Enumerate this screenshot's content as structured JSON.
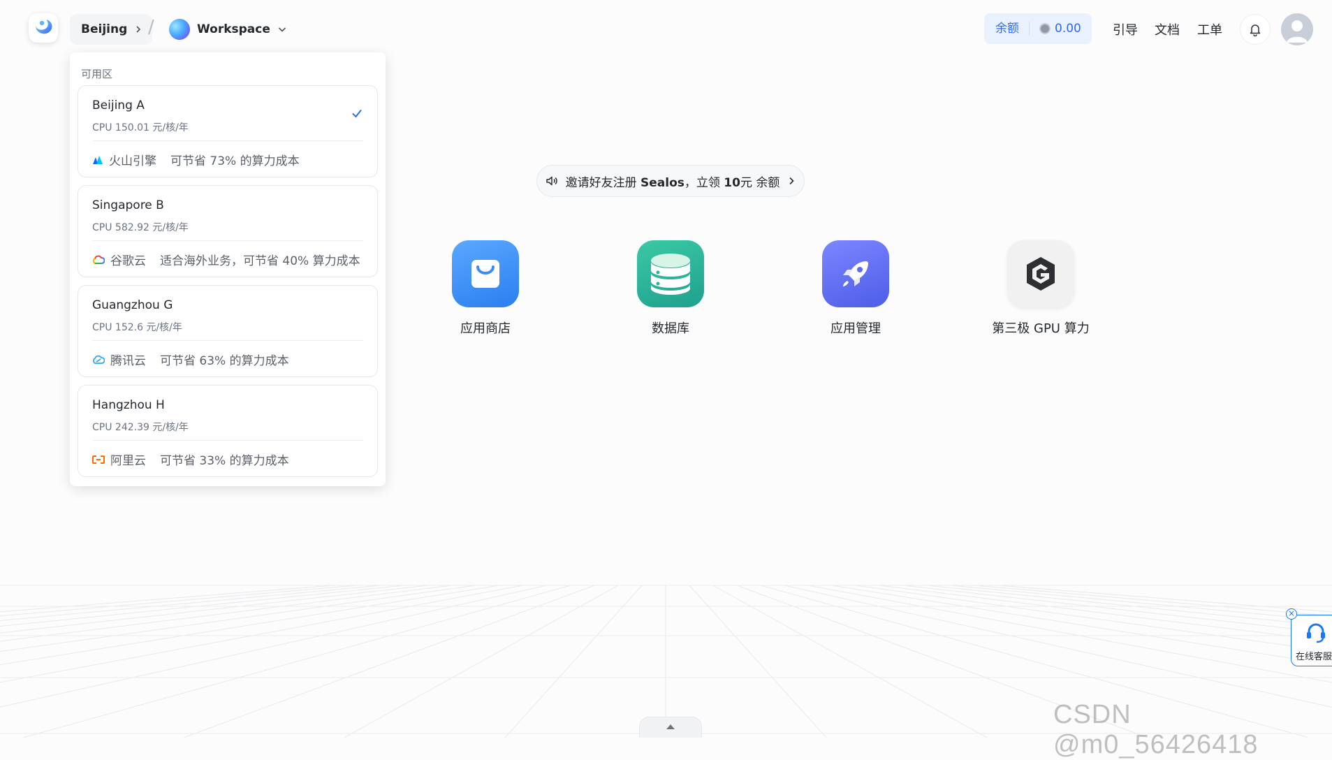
{
  "header": {
    "region": "Beijing",
    "workspace": "Workspace",
    "balance_label": "余额",
    "balance_value": "0.00",
    "nav": [
      "引导",
      "文档",
      "工单"
    ]
  },
  "dropdown": {
    "title": "可用区",
    "zones": [
      {
        "name": "Beijing A",
        "price": "CPU 150.01 元/核/年",
        "provider": "火山引擎",
        "note": "可节省 73% 的算力成本",
        "selected": true,
        "provider_color": "#1664ff"
      },
      {
        "name": "Singapore B",
        "price": "CPU 582.92 元/核/年",
        "provider": "谷歌云",
        "note": "适合海外业务，可节省 40% 算力成本",
        "selected": false,
        "provider_color": "#ea4335"
      },
      {
        "name": "Guangzhou G",
        "price": "CPU 152.6 元/核/年",
        "provider": "腾讯云",
        "note": "可节省 63% 的算力成本",
        "selected": false,
        "provider_color": "#2fa7f2"
      },
      {
        "name": "Hangzhou H",
        "price": "CPU 242.39 元/核/年",
        "provider": "阿里云",
        "note": "可节省 33% 的算力成本",
        "selected": false,
        "provider_color": "#ff6a00"
      }
    ]
  },
  "invite": {
    "pre": "邀请好友注册 ",
    "brand": "Sealos",
    "mid": "，立领 ",
    "amount": "10",
    "post": "元 余额"
  },
  "apps": [
    {
      "label": "应用商店",
      "icon": "shopping-bag-icon",
      "color": "#3b8cf6"
    },
    {
      "label": "数据库",
      "icon": "database-icon",
      "color": "#27b39b"
    },
    {
      "label": "应用管理",
      "icon": "rocket-icon",
      "color": "#5b6cf0"
    },
    {
      "label": "第三极 GPU 算力",
      "icon": "g-logo-icon",
      "color": "#eeeeee"
    }
  ],
  "support": {
    "label": "在线客服"
  },
  "watermark": "CSDN @m0_56426418",
  "colors": {
    "accent": "#2c6bf0",
    "balance_bg": "#e9f1ff"
  }
}
